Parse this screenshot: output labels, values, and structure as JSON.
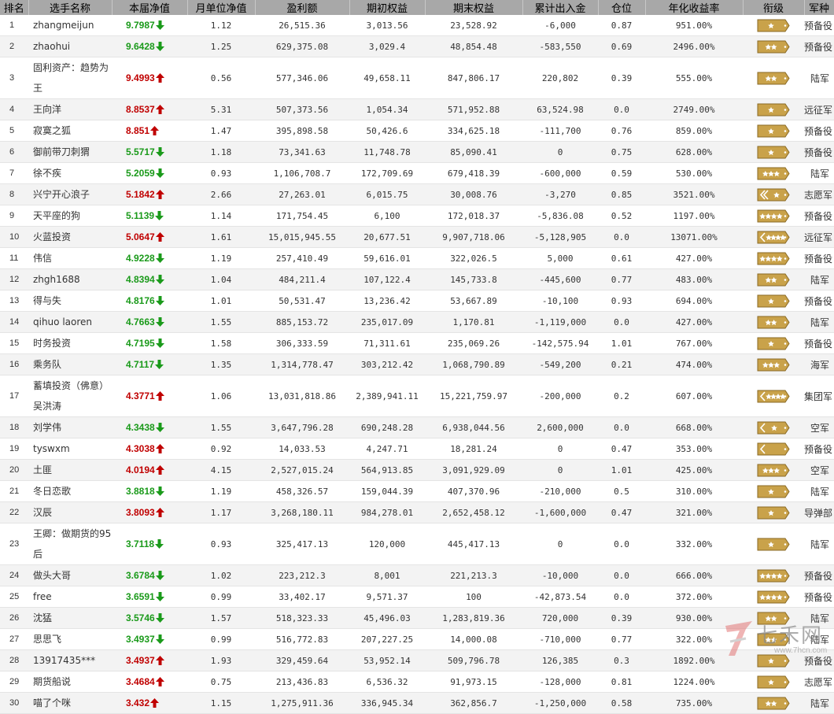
{
  "columns": [
    "排名",
    "选手名称",
    "本届净值",
    "月单位净值",
    "盈利额",
    "期初权益",
    "期末权益",
    "累计出入金",
    "仓位",
    "年化收益率",
    "衔级",
    "军种"
  ],
  "colors": {
    "up": "#c00000",
    "down": "#1a9a1a",
    "header_bg": "#a8a8a8",
    "badge_gold": "#c9a24a"
  },
  "rows": [
    {
      "rank": "1",
      "name": "zhangmeijun",
      "nav": "9.7987",
      "dir": "down",
      "monthly": "1.12",
      "profit": "26,515.36",
      "start": "3,013.56",
      "end": "23,528.92",
      "flow": "-6,000",
      "position": "0.87",
      "annual": "951.00%",
      "badge": "one-star",
      "corps": "预备役"
    },
    {
      "rank": "2",
      "name": "zhaohui",
      "nav": "9.6428",
      "dir": "down",
      "monthly": "1.25",
      "profit": "629,375.08",
      "start": "3,029.4",
      "end": "48,854.48",
      "flow": "-583,550",
      "position": "0.69",
      "annual": "2496.00%",
      "badge": "two-star",
      "corps": "预备役"
    },
    {
      "rank": "3",
      "name": "固利资产：趋势为王",
      "nav": "9.4993",
      "dir": "up",
      "monthly": "0.56",
      "profit": "577,346.06",
      "start": "49,658.11",
      "end": "847,806.17",
      "flow": "220,802",
      "position": "0.39",
      "annual": "555.00%",
      "badge": "two-star",
      "corps": "陆军"
    },
    {
      "rank": "4",
      "name": "王向洋",
      "nav": "8.8537",
      "dir": "up",
      "monthly": "5.31",
      "profit": "507,373.56",
      "start": "1,054.34",
      "end": "571,952.88",
      "flow": "63,524.98",
      "position": "0.0",
      "annual": "2749.00%",
      "badge": "one-star",
      "corps": "远征军"
    },
    {
      "rank": "5",
      "name": "寂寞之狐",
      "nav": "8.851",
      "dir": "up",
      "monthly": "1.47",
      "profit": "395,898.58",
      "start": "50,426.6",
      "end": "334,625.18",
      "flow": "-111,700",
      "position": "0.76",
      "annual": "859.00%",
      "badge": "one-star",
      "corps": "预备役"
    },
    {
      "rank": "6",
      "name": "御前带刀刺猬",
      "nav": "5.5717",
      "dir": "down",
      "monthly": "1.18",
      "profit": "73,341.63",
      "start": "11,748.78",
      "end": "85,090.41",
      "flow": "0",
      "position": "0.75",
      "annual": "628.00%",
      "badge": "one-star",
      "corps": "预备役"
    },
    {
      "rank": "7",
      "name": "徐不疾",
      "nav": "5.2059",
      "dir": "down",
      "monthly": "0.93",
      "profit": "1,106,708.7",
      "start": "172,709.69",
      "end": "679,418.39",
      "flow": "-600,000",
      "position": "0.59",
      "annual": "530.00%",
      "badge": "three-star",
      "corps": "陆军"
    },
    {
      "rank": "8",
      "name": "兴宁开心浪子",
      "nav": "5.1842",
      "dir": "up",
      "monthly": "2.66",
      "profit": "27,263.01",
      "start": "6,015.75",
      "end": "30,008.76",
      "flow": "-3,270",
      "position": "0.85",
      "annual": "3521.00%",
      "badge": "chevron-two",
      "corps": "志愿军"
    },
    {
      "rank": "9",
      "name": "天平座的狗",
      "nav": "5.1139",
      "dir": "down",
      "monthly": "1.14",
      "profit": "171,754.45",
      "start": "6,100",
      "end": "172,018.37",
      "flow": "-5,836.08",
      "position": "0.52",
      "annual": "1197.00%",
      "badge": "four-star",
      "corps": "预备役"
    },
    {
      "rank": "10",
      "name": "火蓝投资",
      "nav": "5.0647",
      "dir": "up",
      "monthly": "1.61",
      "profit": "15,015,945.55",
      "start": "20,677.51",
      "end": "9,907,718.06",
      "flow": "-5,128,905",
      "position": "0.0",
      "annual": "13071.00%",
      "badge": "chevron-four",
      "corps": "远征军"
    },
    {
      "rank": "11",
      "name": "伟信",
      "nav": "4.9228",
      "dir": "down",
      "monthly": "1.19",
      "profit": "257,410.49",
      "start": "59,616.01",
      "end": "322,026.5",
      "flow": "5,000",
      "position": "0.61",
      "annual": "427.00%",
      "badge": "four-star",
      "corps": "预备役"
    },
    {
      "rank": "12",
      "name": "zhgh1688",
      "nav": "4.8394",
      "dir": "down",
      "monthly": "1.04",
      "profit": "484,211.4",
      "start": "107,122.4",
      "end": "145,733.8",
      "flow": "-445,600",
      "position": "0.77",
      "annual": "483.00%",
      "badge": "two-star",
      "corps": "陆军"
    },
    {
      "rank": "13",
      "name": "得与失",
      "nav": "4.8176",
      "dir": "down",
      "monthly": "1.01",
      "profit": "50,531.47",
      "start": "13,236.42",
      "end": "53,667.89",
      "flow": "-10,100",
      "position": "0.93",
      "annual": "694.00%",
      "badge": "one-star",
      "corps": "预备役"
    },
    {
      "rank": "14",
      "name": "qihuo laoren",
      "nav": "4.7663",
      "dir": "down",
      "monthly": "1.55",
      "profit": "885,153.72",
      "start": "235,017.09",
      "end": "1,170.81",
      "flow": "-1,119,000",
      "position": "0.0",
      "annual": "427.00%",
      "badge": "two-star",
      "corps": "陆军"
    },
    {
      "rank": "15",
      "name": "时务投资",
      "nav": "4.7195",
      "dir": "down",
      "monthly": "1.58",
      "profit": "306,333.59",
      "start": "71,311.61",
      "end": "235,069.26",
      "flow": "-142,575.94",
      "position": "1.01",
      "annual": "767.00%",
      "badge": "one-star",
      "corps": "预备役"
    },
    {
      "rank": "16",
      "name": "乘务队",
      "nav": "4.7117",
      "dir": "down",
      "monthly": "1.35",
      "profit": "1,314,778.47",
      "start": "303,212.42",
      "end": "1,068,790.89",
      "flow": "-549,200",
      "position": "0.21",
      "annual": "474.00%",
      "badge": "three-star",
      "corps": "海军"
    },
    {
      "rank": "17",
      "name": "蓄填投资（佛意）吴洪涛",
      "nav": "4.3771",
      "dir": "up",
      "monthly": "1.06",
      "profit": "13,031,818.86",
      "start": "2,389,941.11",
      "end": "15,221,759.97",
      "flow": "-200,000",
      "position": "0.2",
      "annual": "607.00%",
      "badge": "chevron-four",
      "corps": "集团军"
    },
    {
      "rank": "18",
      "name": "刘学伟",
      "nav": "4.3438",
      "dir": "down",
      "monthly": "1.55",
      "profit": "3,647,796.28",
      "start": "690,248.28",
      "end": "6,938,044.56",
      "flow": "2,600,000",
      "position": "0.0",
      "annual": "668.00%",
      "badge": "chevron-one",
      "corps": "空军"
    },
    {
      "rank": "19",
      "name": "tyswxm",
      "nav": "4.3038",
      "dir": "up",
      "monthly": "0.92",
      "profit": "14,033.53",
      "start": "4,247.71",
      "end": "18,281.24",
      "flow": "0",
      "position": "0.47",
      "annual": "353.00%",
      "badge": "chevron-plain",
      "corps": "预备役"
    },
    {
      "rank": "20",
      "name": "土匪",
      "nav": "4.0194",
      "dir": "up",
      "monthly": "4.15",
      "profit": "2,527,015.24",
      "start": "564,913.85",
      "end": "3,091,929.09",
      "flow": "0",
      "position": "1.01",
      "annual": "425.00%",
      "badge": "three-star",
      "corps": "空军"
    },
    {
      "rank": "21",
      "name": "冬日恋歌",
      "nav": "3.8818",
      "dir": "down",
      "monthly": "1.19",
      "profit": "458,326.57",
      "start": "159,044.39",
      "end": "407,370.96",
      "flow": "-210,000",
      "position": "0.5",
      "annual": "310.00%",
      "badge": "one-star",
      "corps": "陆军"
    },
    {
      "rank": "22",
      "name": "汉辰",
      "nav": "3.8093",
      "dir": "up",
      "monthly": "1.17",
      "profit": "3,268,180.11",
      "start": "984,278.01",
      "end": "2,652,458.12",
      "flow": "-1,600,000",
      "position": "0.47",
      "annual": "321.00%",
      "badge": "one-star",
      "corps": "导弹部"
    },
    {
      "rank": "23",
      "name": "王卿：做期货的95后",
      "nav": "3.7118",
      "dir": "down",
      "monthly": "0.93",
      "profit": "325,417.13",
      "start": "120,000",
      "end": "445,417.13",
      "flow": "0",
      "position": "0.0",
      "annual": "332.00%",
      "badge": "one-star",
      "corps": "陆军"
    },
    {
      "rank": "24",
      "name": "做头大哥",
      "nav": "3.6784",
      "dir": "down",
      "monthly": "1.02",
      "profit": "223,212.3",
      "start": "8,001",
      "end": "221,213.3",
      "flow": "-10,000",
      "position": "0.0",
      "annual": "666.00%",
      "badge": "four-star",
      "corps": "预备役"
    },
    {
      "rank": "25",
      "name": "free",
      "nav": "3.6591",
      "dir": "down",
      "monthly": "0.99",
      "profit": "33,402.17",
      "start": "9,571.37",
      "end": "100",
      "flow": "-42,873.54",
      "position": "0.0",
      "annual": "372.00%",
      "badge": "four-star",
      "corps": "预备役"
    },
    {
      "rank": "26",
      "name": "沈猛",
      "nav": "3.5746",
      "dir": "down",
      "monthly": "1.57",
      "profit": "518,323.33",
      "start": "45,496.03",
      "end": "1,283,819.36",
      "flow": "720,000",
      "position": "0.39",
      "annual": "930.00%",
      "badge": "two-star",
      "corps": "陆军"
    },
    {
      "rank": "27",
      "name": "思思飞",
      "nav": "3.4937",
      "dir": "down",
      "monthly": "0.99",
      "profit": "516,772.83",
      "start": "207,227.25",
      "end": "14,000.08",
      "flow": "-710,000",
      "position": "0.77",
      "annual": "322.00%",
      "badge": "two-star",
      "corps": "陆军"
    },
    {
      "rank": "28",
      "name": "13917435***",
      "nav": "3.4937",
      "dir": "up",
      "monthly": "1.93",
      "profit": "329,459.64",
      "start": "53,952.14",
      "end": "509,796.78",
      "flow": "126,385",
      "position": "0.3",
      "annual": "1892.00%",
      "badge": "one-star",
      "corps": "预备役"
    },
    {
      "rank": "29",
      "name": "期货船说",
      "nav": "3.4684",
      "dir": "up",
      "monthly": "0.75",
      "profit": "213,436.83",
      "start": "6,536.32",
      "end": "91,973.15",
      "flow": "-128,000",
      "position": "0.81",
      "annual": "1224.00%",
      "badge": "one-star",
      "corps": "志愿军"
    },
    {
      "rank": "30",
      "name": "喵了个咪",
      "nav": "3.432",
      "dir": "up",
      "monthly": "1.15",
      "profit": "1,275,911.36",
      "start": "336,945.34",
      "end": "362,856.7",
      "flow": "-1,250,000",
      "position": "0.58",
      "annual": "735.00%",
      "badge": "two-star",
      "corps": "陆军"
    }
  ],
  "watermark": {
    "text": "七禾网",
    "url": "www.7hcn.com"
  }
}
